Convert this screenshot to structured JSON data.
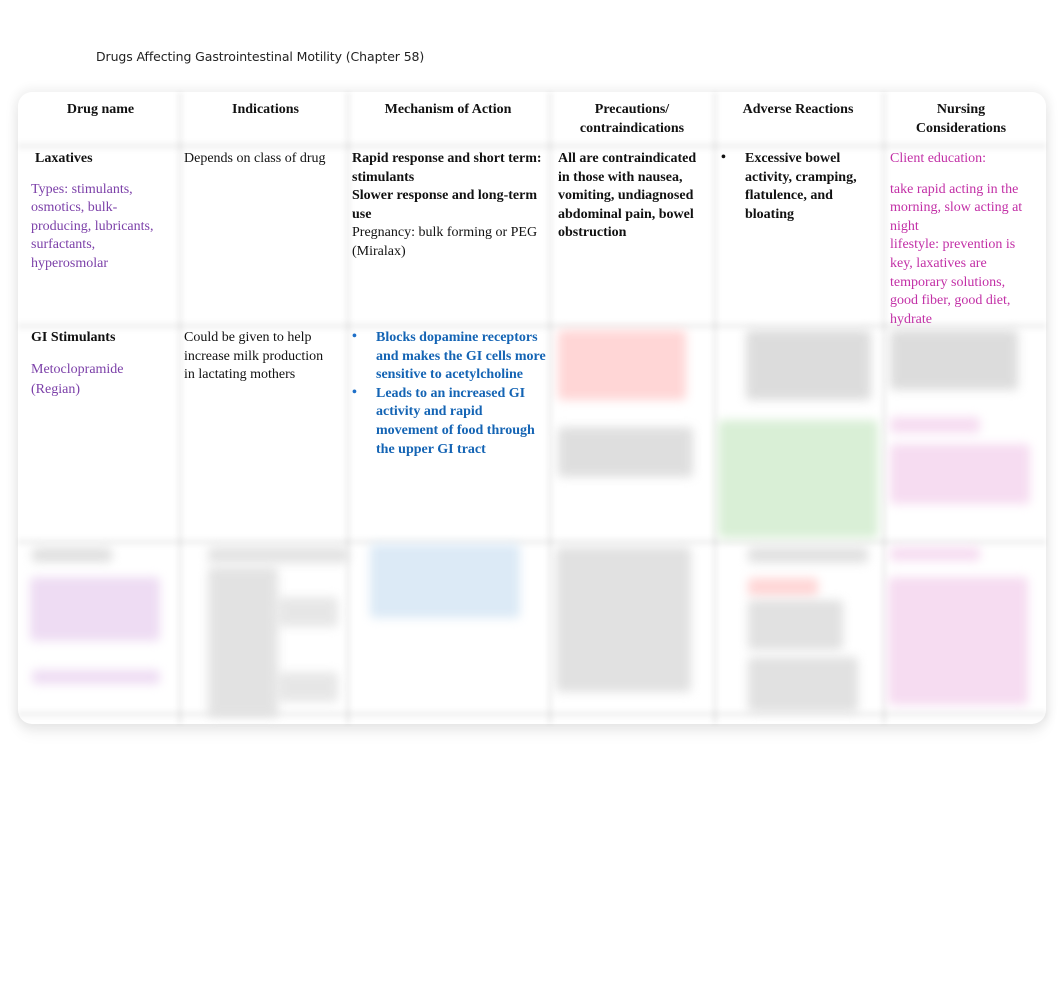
{
  "document": {
    "title": "Drugs Affecting Gastrointestinal Motility (Chapter 58)"
  },
  "table": {
    "headers": {
      "drug_name": "Drug name",
      "indications": "Indications",
      "mechanism": "Mechanism of Action",
      "precautions_line1": "Precautions/",
      "precautions_line2": "contraindications",
      "adverse": "Adverse Reactions",
      "nursing_line1": "Nursing",
      "nursing_line2": "Considerations"
    },
    "rows": [
      {
        "drug_name": "Laxatives",
        "drug_detail": "Types: stimulants, osmotics, bulk-producing, lubricants, surfactants, hyperosmolar",
        "indications": "Depends on class of drug",
        "mechanism": {
          "line1": "Rapid response and short term: stimulants",
          "line2": "Slower response and long-term use",
          "line3": "Pregnancy: bulk forming or PEG (Miralax)"
        },
        "precautions": "All are contraindicated in those with nausea, vomiting, undiagnosed abdominal pain, bowel obstruction",
        "adverse": [
          "Excessive bowel activity, cramping, flatulence, and bloating"
        ],
        "nursing": {
          "heading": "Client education:",
          "text1": "take rapid acting in the morning, slow acting at night",
          "text2": "lifestyle: prevention is key, laxatives are temporary solutions, good fiber, good diet, hydrate"
        }
      },
      {
        "drug_name": "GI Stimulants",
        "drug_detail": "Metoclopramide (Regian)",
        "indications": "Could be given to help increase milk production in lactating mothers",
        "mechanism_bullets": [
          "Blocks dopamine receptors and makes the GI cells more sensitive to acetylcholine",
          "Leads to an increased GI activity and rapid movement of food through the upper GI tract"
        ],
        "precautions": "[blurred]",
        "adverse": "[blurred]",
        "nursing": "[blurred]"
      },
      {
        "drug_name": "[blurred]",
        "drug_detail": "[blurred]",
        "indications": "[blurred]",
        "mechanism": "[blurred]",
        "precautions": "[blurred]",
        "adverse": "[blurred]",
        "nursing": "[blurred]"
      }
    ]
  }
}
